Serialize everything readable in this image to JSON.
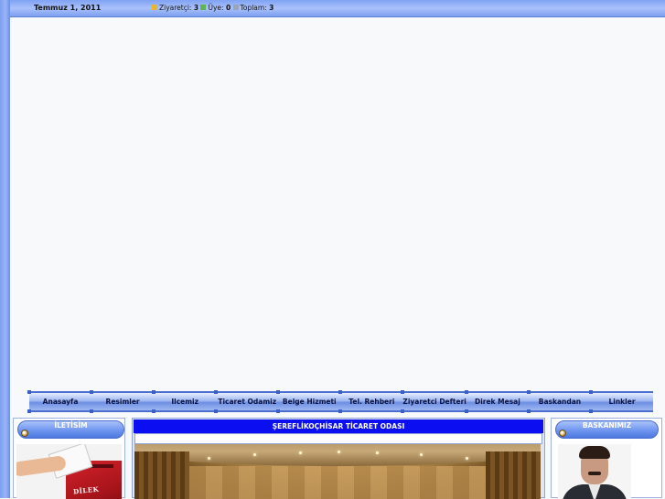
{
  "header": {
    "date": "Temmuz 1, 2011",
    "stats": [
      {
        "label": "Ziyaretçi:",
        "value": "3",
        "icon": "visitor-icon"
      },
      {
        "label": "Üye:",
        "value": "0",
        "icon": "member-icon"
      },
      {
        "label": "Toplam:",
        "value": "3",
        "icon": "total-icon"
      }
    ]
  },
  "nav": {
    "items": [
      "Anasayfa",
      "Resimler",
      "Ilcemiz",
      "Ticaret Odamiz",
      "Belge Hizmeti",
      "Tel. Rehberi",
      "Ziyaretci Defteri",
      "Direk Mesaj",
      "Baskandan",
      "Linkler"
    ]
  },
  "left_box": {
    "title": "İLETİSİM",
    "image_text": "DİLEK"
  },
  "main": {
    "title": "ŞEREFLİKOÇHİSAR TİCARET ODASI"
  },
  "right_box": {
    "title": "BASKANIMIZ"
  },
  "colors": {
    "bar_blue": "#7fa2f2",
    "title_blue": "#0a0ef0",
    "box_red": "#d3222a"
  }
}
